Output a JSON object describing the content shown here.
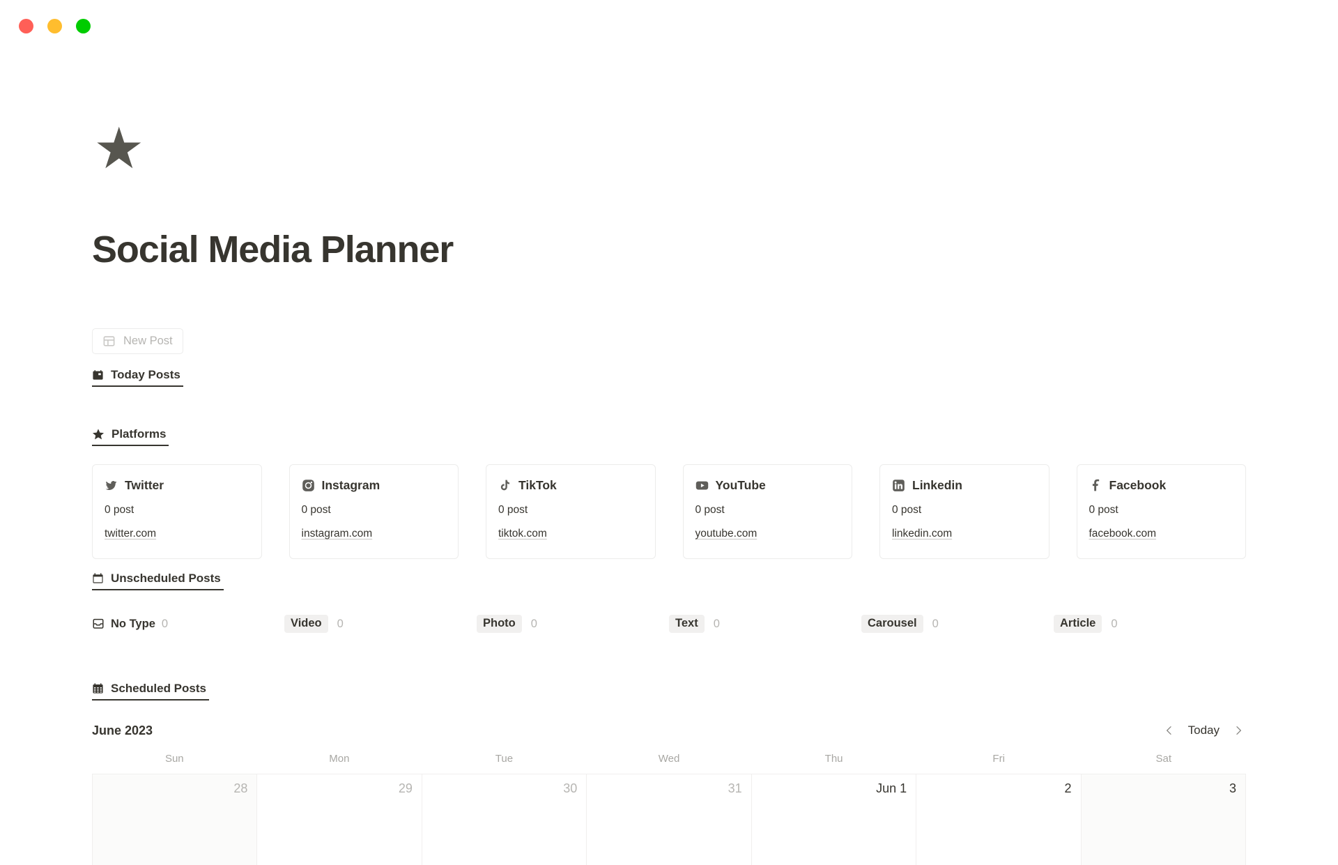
{
  "window": {
    "controls": [
      {
        "name": "close",
        "color": "#ff5f57"
      },
      {
        "name": "minimize",
        "color": "#ffbd2e"
      },
      {
        "name": "maximize",
        "color": "#00cc00"
      }
    ]
  },
  "page": {
    "icon": "★",
    "title": "Social Media Planner"
  },
  "toolbar": {
    "new_post_label": "New Post"
  },
  "sections": {
    "today_posts": {
      "label": "Today Posts",
      "icon": "calendar-day-icon"
    },
    "platforms": {
      "label": "Platforms",
      "icon": "star-icon"
    },
    "unscheduled_posts": {
      "label": "Unscheduled Posts",
      "icon": "calendar-icon"
    },
    "scheduled_posts": {
      "label": "Scheduled Posts",
      "icon": "calendar-grid-icon"
    }
  },
  "platforms": [
    {
      "name": "Twitter",
      "posts": "0 post",
      "url": "twitter.com",
      "icon": "twitter-icon"
    },
    {
      "name": "Instagram",
      "posts": "0 post",
      "url": "instagram.com",
      "icon": "instagram-icon"
    },
    {
      "name": "TikTok",
      "posts": "0 post",
      "url": "tiktok.com",
      "icon": "tiktok-icon"
    },
    {
      "name": "YouTube",
      "posts": "0 post",
      "url": "youtube.com",
      "icon": "youtube-icon"
    },
    {
      "name": "Linkedin",
      "posts": "0 post",
      "url": "linkedin.com",
      "icon": "linkedin-icon"
    },
    {
      "name": "Facebook",
      "posts": "0 post",
      "url": "facebook.com",
      "icon": "facebook-icon"
    }
  ],
  "post_types": [
    {
      "label": "No Type",
      "count": "0",
      "chip": false,
      "icon": "inbox-icon"
    },
    {
      "label": "Video",
      "count": "0",
      "chip": true
    },
    {
      "label": "Photo",
      "count": "0",
      "chip": true
    },
    {
      "label": "Text",
      "count": "0",
      "chip": true
    },
    {
      "label": "Carousel",
      "count": "0",
      "chip": true
    },
    {
      "label": "Article",
      "count": "0",
      "chip": true
    }
  ],
  "calendar": {
    "month_label": "June 2023",
    "today_label": "Today",
    "prev_icon": "chevron-left-icon",
    "next_icon": "chevron-right-icon",
    "day_names": [
      "Sun",
      "Mon",
      "Tue",
      "Wed",
      "Thu",
      "Fri",
      "Sat"
    ],
    "cells": [
      {
        "label": "28",
        "muted": true,
        "weekend": true
      },
      {
        "label": "29",
        "muted": true,
        "weekend": false
      },
      {
        "label": "30",
        "muted": true,
        "weekend": false
      },
      {
        "label": "31",
        "muted": true,
        "weekend": false
      },
      {
        "label": "Jun 1",
        "muted": false,
        "weekend": false
      },
      {
        "label": "2",
        "muted": false,
        "weekend": false
      },
      {
        "label": "3",
        "muted": false,
        "weekend": true
      }
    ]
  },
  "colors": {
    "text": "#37352f",
    "muted": "#b6b5b2",
    "border": "#ececeb",
    "chip_bg": "#f1f0ef",
    "weekend_bg": "#fbfbfa"
  }
}
